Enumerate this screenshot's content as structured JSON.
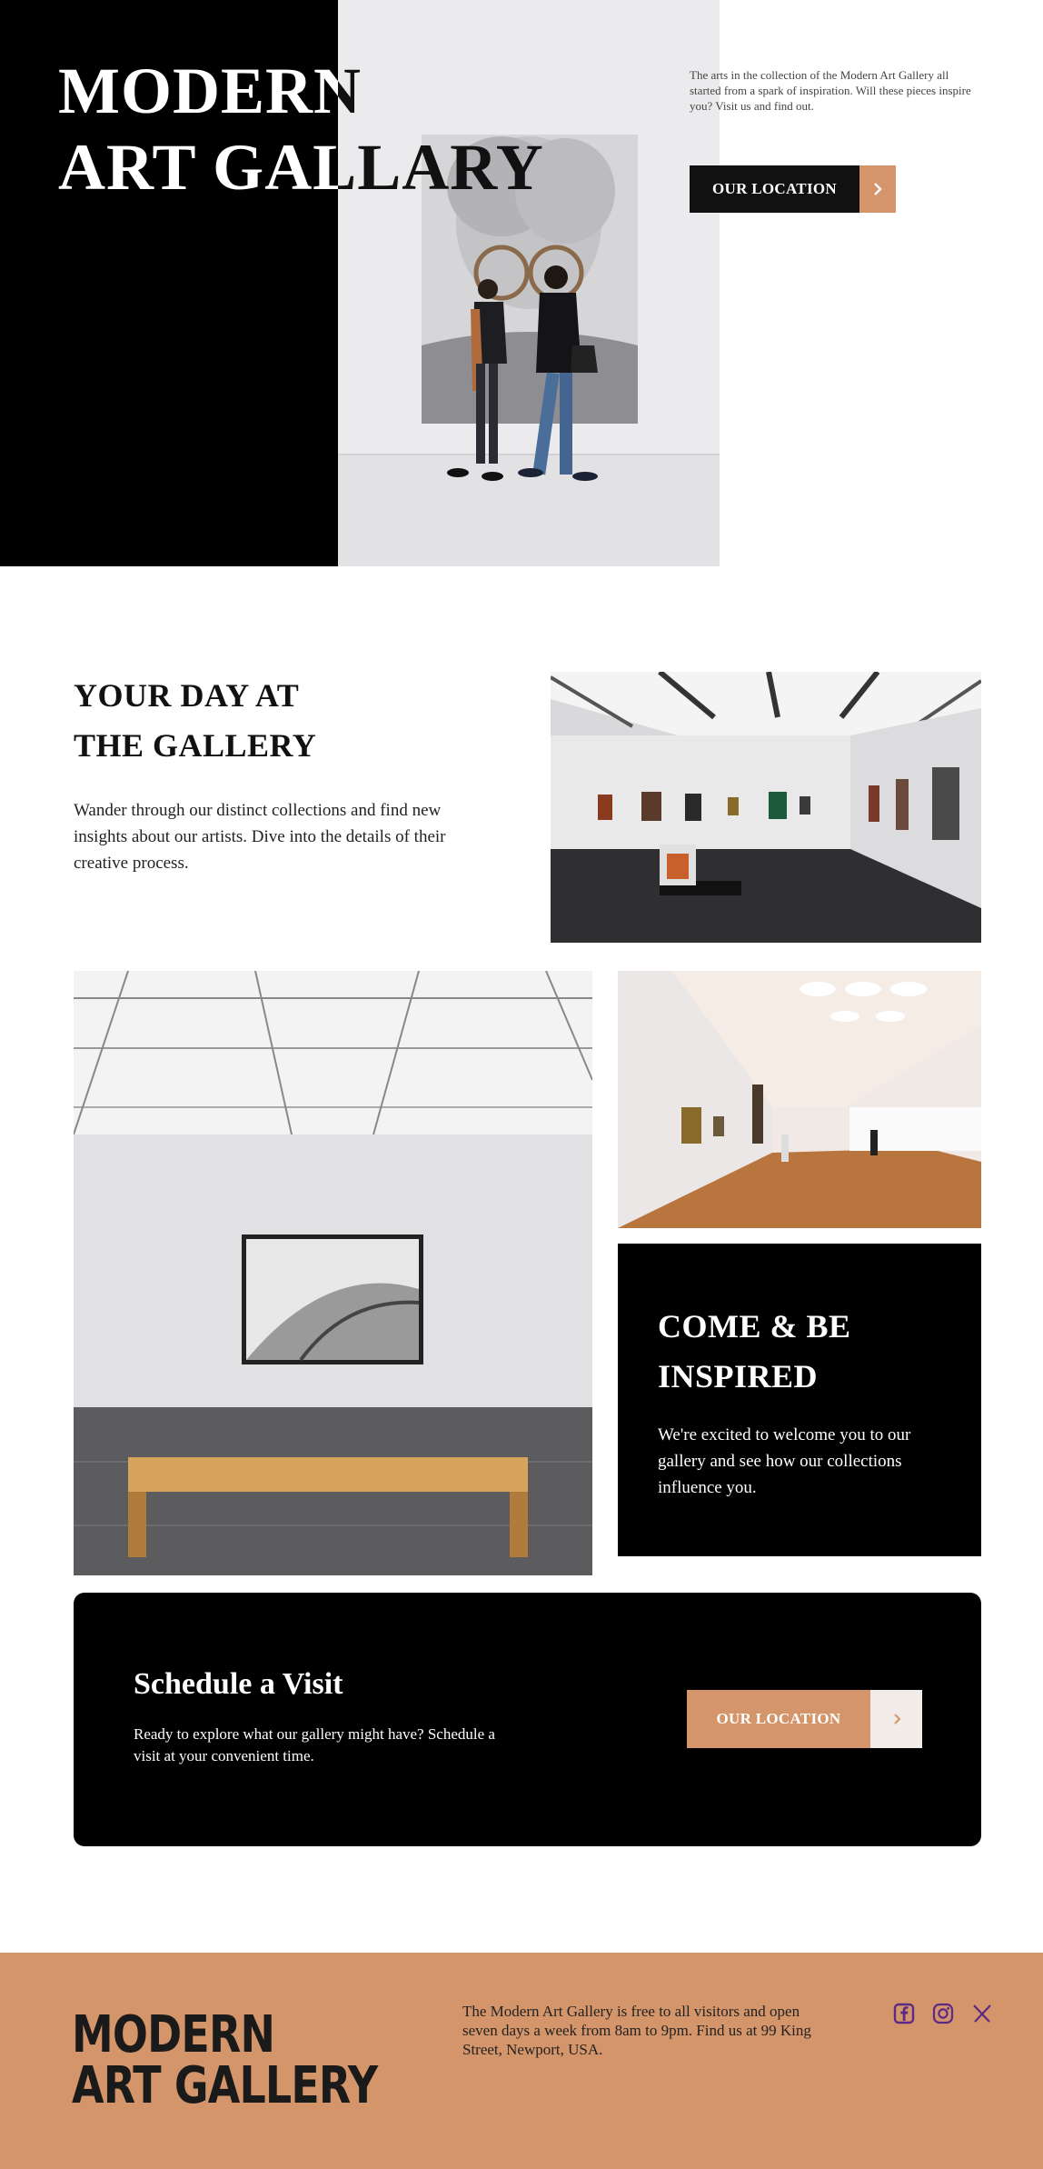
{
  "hero": {
    "title_line1": "MODERN",
    "title_line2": "ART GALLARY",
    "intro": "The arts in the collection of the Modern Art Gallery all started from a spark of inspiration. Will these pieces inspire you? Visit us and find out.",
    "button_label": "OUR LOCATION"
  },
  "day": {
    "title_line1": "YOUR DAY AT",
    "title_line2": "THE GALLERY",
    "text": "Wander through our distinct collections and find new insights about our artists. Dive into the details of their creative process."
  },
  "inspired": {
    "title_line1": "COME & BE",
    "title_line2": "INSPIRED",
    "text": "We're excited to welcome you to our gallery and see how our collections influence you."
  },
  "schedule": {
    "title": "Schedule a Visit",
    "text": "Ready to explore what our gallery might have? Schedule a visit at your convenient time.",
    "button_label": "OUR LOCATION"
  },
  "footer": {
    "logo_line1": "MODERN",
    "logo_line2": "ART GALLERY",
    "text": "The Modern Art Gallery is free to all visitors and open seven days a week from 8am to 9pm. Find us at 99 King Street, Newport, USA.",
    "social_icons": [
      "facebook-icon",
      "instagram-icon",
      "x-twitter-icon"
    ]
  },
  "colors": {
    "accent": "#d4956a",
    "dark": "#000000",
    "light": "#ffffff",
    "social": "#5b2a86"
  }
}
